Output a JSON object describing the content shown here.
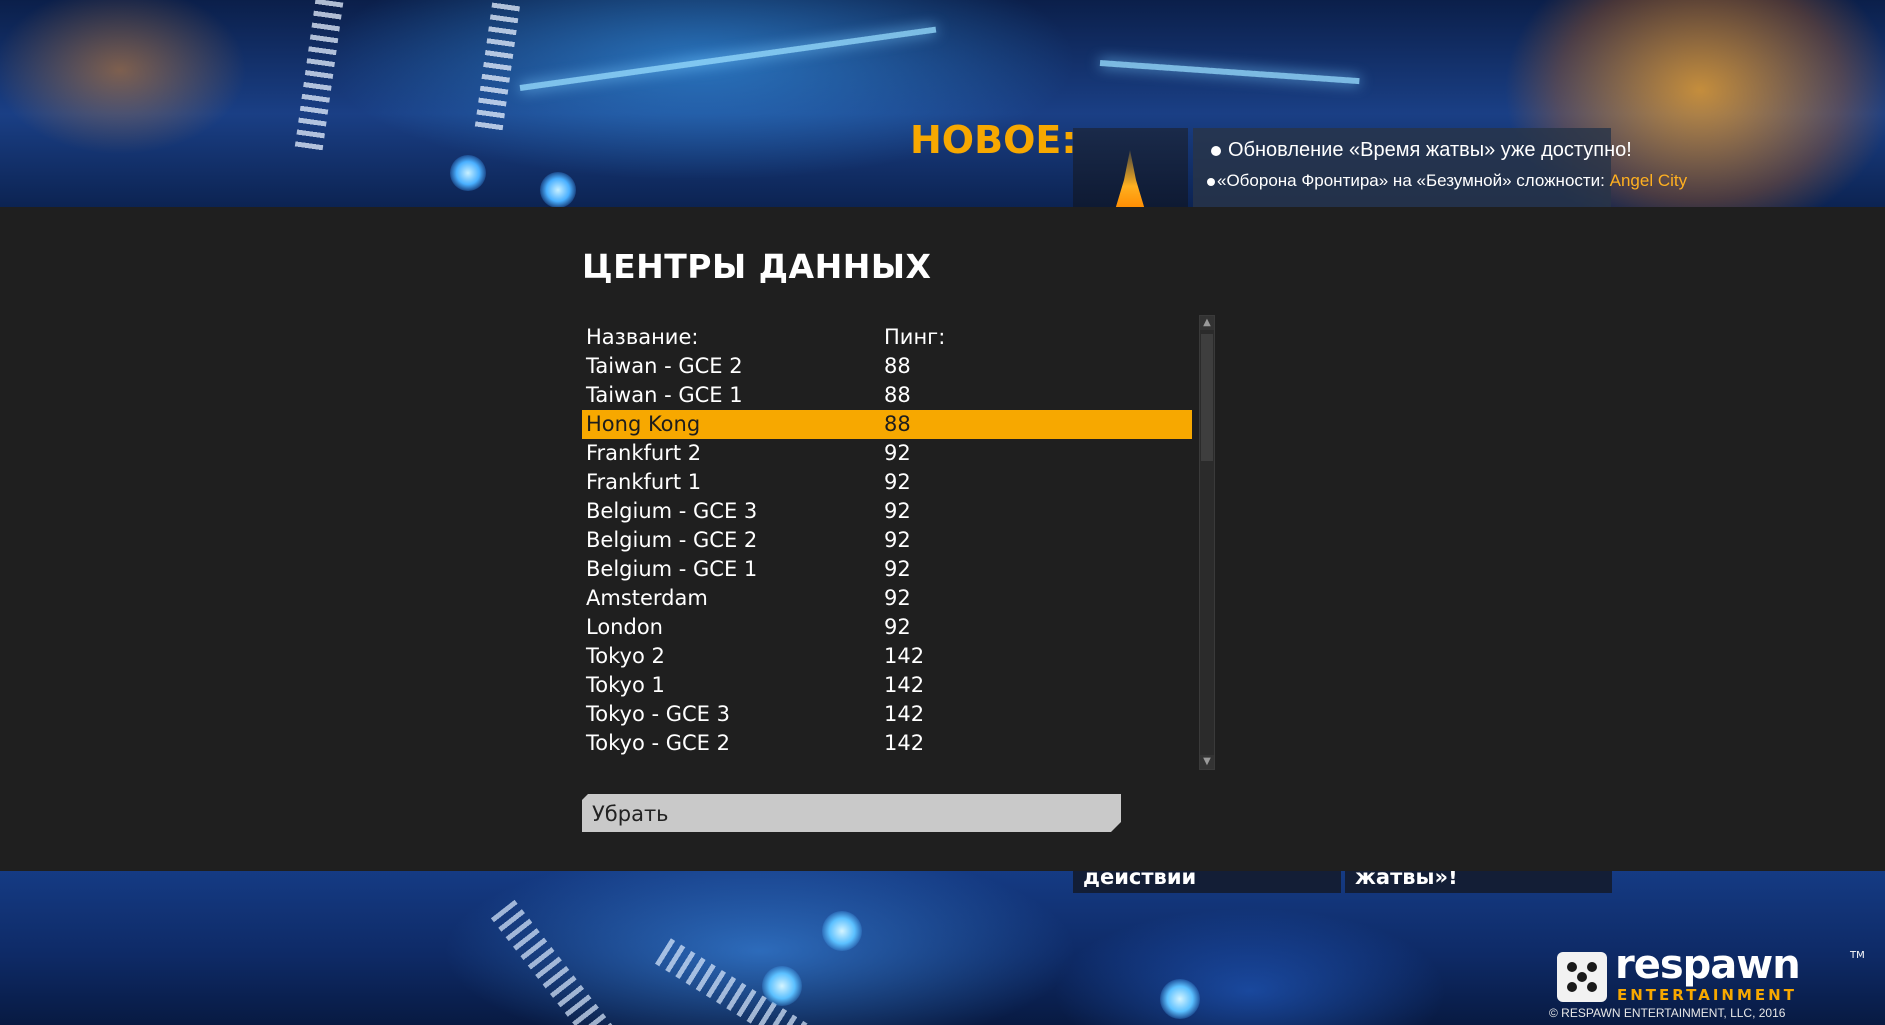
{
  "theme": {
    "accent": "#f7a800",
    "panel_bg": "#1f1f1f",
    "text": "#ffffff",
    "highlight_text": "#ffb020",
    "button_bg": "#c9c9c9"
  },
  "news": {
    "title": "НОВОЕ:",
    "thumb_icon": "flame-icon",
    "items": [
      {
        "text": "Обновление «Время жатвы» уже доступно!"
      },
      {
        "prefix": "«Оборона Фронтира» на «Безумной» сложности:",
        "highlight": "Angel City"
      }
    ]
  },
  "datacenters": {
    "title": "ЦЕНТРЫ ДАННЫХ",
    "col_name": "Название:",
    "col_ping": "Пинг:",
    "rows": [
      {
        "name": "Taiwan - GCE 2",
        "ping": "88"
      },
      {
        "name": "Taiwan - GCE 1",
        "ping": "88"
      },
      {
        "name": "Hong Kong",
        "ping": "88",
        "selected": true
      },
      {
        "name": "Frankfurt 2",
        "ping": "92"
      },
      {
        "name": "Frankfurt 1",
        "ping": "92"
      },
      {
        "name": "Belgium - GCE 3",
        "ping": "92"
      },
      {
        "name": "Belgium - GCE 2",
        "ping": "92"
      },
      {
        "name": "Belgium - GCE 1",
        "ping": "92"
      },
      {
        "name": "Amsterdam",
        "ping": "92"
      },
      {
        "name": "London",
        "ping": "92"
      },
      {
        "name": "Tokyo 2",
        "ping": "142"
      },
      {
        "name": "Tokyo 1",
        "ping": "142"
      },
      {
        "name": "Tokyo - GCE 3",
        "ping": "142"
      },
      {
        "name": "Tokyo - GCE 2",
        "ping": "142"
      }
    ],
    "dismiss_label": "Убрать"
  },
  "lower_tiles": {
    "left": "действий",
    "right": "жатвы»!"
  },
  "logo": {
    "word": "respawn",
    "tm": "TM",
    "sub": "ENTERTAINMENT",
    "copyright": "© RESPAWN ENTERTAINMENT, LLC, 2016"
  }
}
